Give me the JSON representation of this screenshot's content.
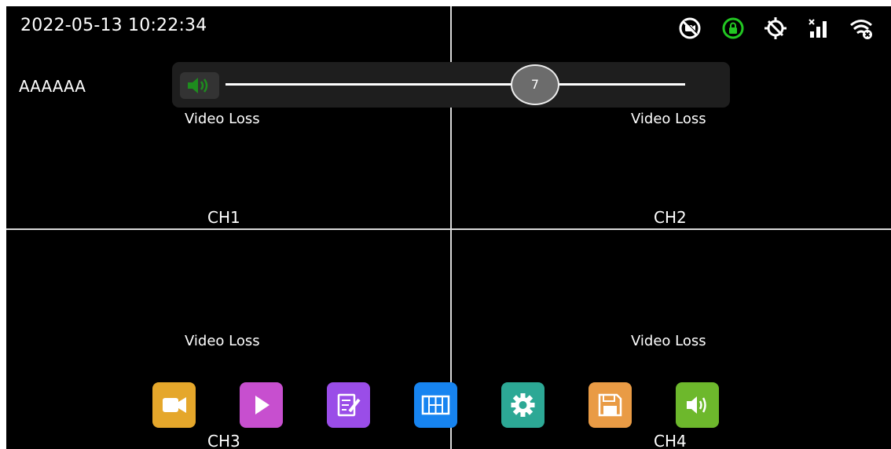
{
  "status": {
    "datetime": "2022-05-13 10:22:34",
    "name": "AAAAAA",
    "icons": [
      "camera-off-icon",
      "lock-icon",
      "gps-off-icon",
      "signal-icon",
      "wifi-off-icon"
    ],
    "lock_color": "#22c722"
  },
  "volume": {
    "value": "7",
    "icon": "speaker-icon",
    "icon_color": "#1e8c1e"
  },
  "channels": [
    {
      "label": "CH1",
      "status": "Video Loss"
    },
    {
      "label": "CH2",
      "status": "Video Loss"
    },
    {
      "label": "CH3",
      "status": "Video Loss"
    },
    {
      "label": "CH4",
      "status": "Video Loss"
    }
  ],
  "toolbar": [
    {
      "icon": "video-camera-icon",
      "color": "#e5a72b"
    },
    {
      "icon": "play-icon",
      "color": "#c74fcf"
    },
    {
      "icon": "edit-icon",
      "color": "#9a4de8"
    },
    {
      "icon": "layout-grid-icon",
      "color": "#1784f0"
    },
    {
      "icon": "gear-icon",
      "color": "#2ca895"
    },
    {
      "icon": "save-icon",
      "color": "#e99b45"
    },
    {
      "icon": "speaker-icon",
      "color": "#6db82c"
    }
  ]
}
